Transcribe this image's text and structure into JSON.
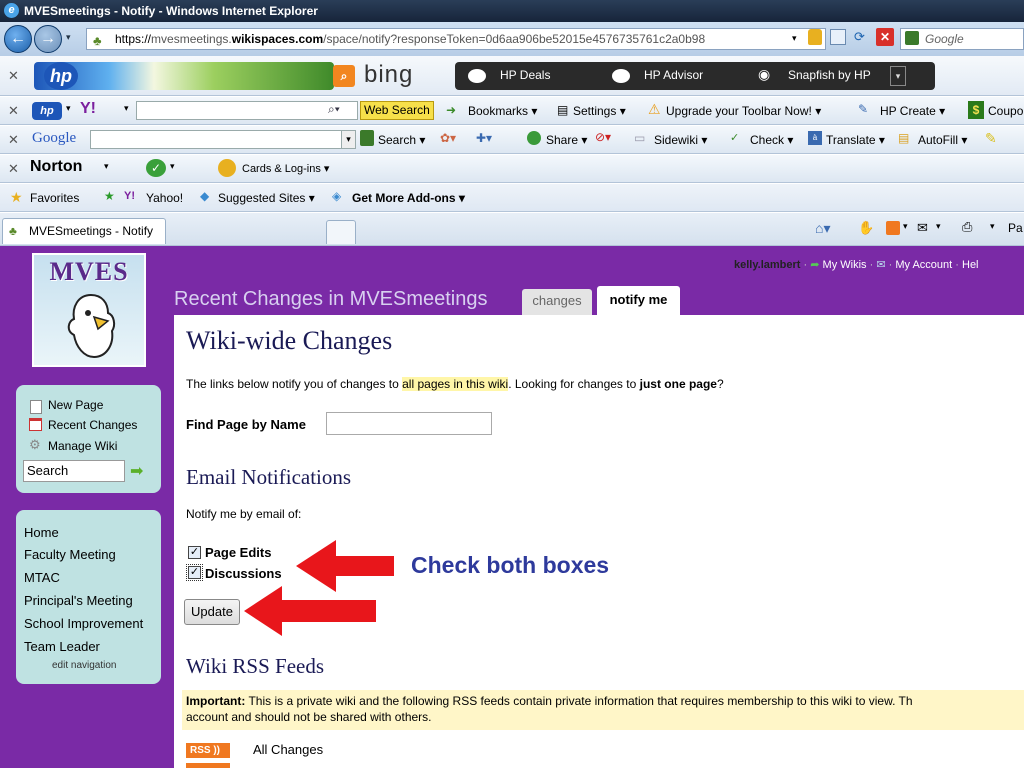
{
  "window": {
    "title": "MVESmeetings - Notify - Windows Internet Explorer"
  },
  "address": {
    "scheme": "https://",
    "host_pre": "mvesmeetings.",
    "host_main": "wikispaces.com",
    "path": "/space/notify?responseToken=0d6aa906be52015e4576735761c2a0b98",
    "search_placeholder": "Google"
  },
  "toolbar_hp": {
    "bing": "bing",
    "items": [
      "HP Deals",
      "HP Advisor",
      "Snapfish by HP"
    ]
  },
  "toolbar_yahoo": {
    "web_search": "Web Search",
    "items": [
      "Bookmarks ▾",
      "Settings ▾",
      "Upgrade your Toolbar Now! ▾",
      "HP Create ▾",
      "Coupo"
    ]
  },
  "toolbar_google": {
    "logo": "Google",
    "search": "Search ▾",
    "items": [
      "Share ▾",
      "Sidewiki ▾",
      "Check ▾",
      "Translate ▾",
      "AutoFill ▾"
    ]
  },
  "toolbar_norton": {
    "logo": "Norton",
    "cards": "Cards & Log-ins ▾"
  },
  "favorites": {
    "label": "Favorites",
    "items": [
      "Yahoo!",
      "Suggested Sites ▾",
      "Get More Add-ons ▾"
    ]
  },
  "tab": {
    "label": "MVESmeetings - Notify",
    "tools_cut": "Pa"
  },
  "wiki": {
    "logo_text": "MVES",
    "user_links": [
      "kelly.lambert",
      "My Wikis",
      "My Account",
      "Hel"
    ],
    "header_title": "Recent Changes in MVESmeetings",
    "tabs": [
      "changes",
      "notify me"
    ],
    "actions": [
      "New Page",
      "Recent Changes",
      "Manage Wiki"
    ],
    "search_value": "Search",
    "nav": [
      "Home",
      "Faculty Meeting",
      "MTAC",
      "Principal's Meeting",
      "School Improvement",
      "Team Leader"
    ],
    "edit_nav": "edit navigation",
    "h_changes": "Wiki-wide Changes",
    "intro_1": "The links below notify you of changes to ",
    "intro_hl": "all pages in this wiki",
    "intro_2": ". Looking for changes to ",
    "intro_bold": "just one page",
    "intro_3": "?",
    "find_label": "Find Page by Name",
    "h_email": "Email Notifications",
    "notify_text": "Notify me by email of:",
    "check_page_edits": "Page Edits",
    "check_discussions": "Discussions",
    "update_button": "Update",
    "h_rss": "Wiki RSS Feeds",
    "important_label": "Important:",
    "important_text": " This is a private wiki and the following RSS feeds contain private information that requires membership to this wiki to view. Th",
    "important_text2": "account and should not be shared with others.",
    "rss_badge": "RSS",
    "rss_all": "All Changes"
  },
  "annotation": {
    "text": "Check both boxes",
    "color": "#2e3a9c",
    "arrow_color": "#e8161b"
  }
}
